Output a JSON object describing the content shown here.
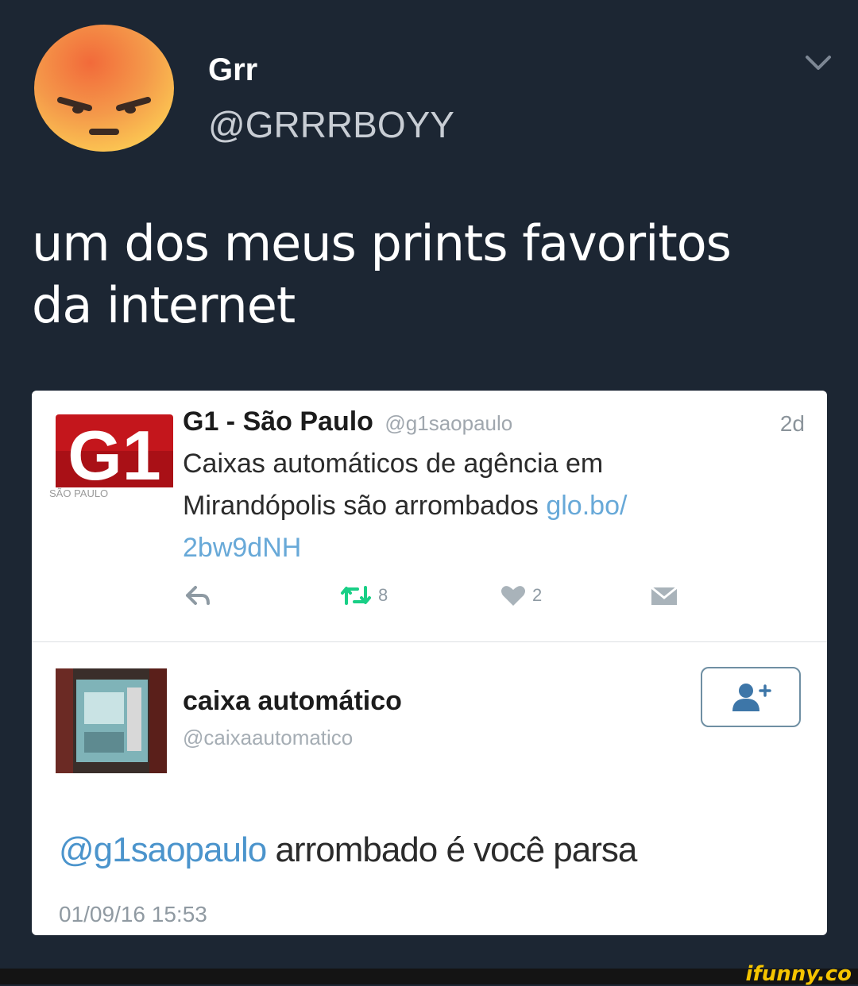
{
  "header": {
    "display_name": "Grr",
    "handle": "@GRRRBOYY"
  },
  "tweet": {
    "line1": "um dos meus prints favoritos",
    "line2": "da internet"
  },
  "quoted_tweet": {
    "logo_text": "G1",
    "logo_subtext": "SÃO PAULO",
    "name": "G1 - São Paulo",
    "handle": "@g1saopaulo",
    "time": "2d",
    "text_line1": "Caixas automáticos de agência em",
    "text_line2_plain": "Mirandópolis são arrombados ",
    "text_line2_link": "glo.bo/",
    "text_line3_link": "2bw9dNH",
    "retweet_count": "8",
    "like_count": "2"
  },
  "reply": {
    "account_name": "caixa automático",
    "account_handle": "@caixaautomatico",
    "mention": "@g1saopaulo",
    "text": " arrombado é você parsa",
    "timestamp": "01/09/16 15:53"
  },
  "watermark": "ifunny.co",
  "colors": {
    "background": "#1c2633",
    "link": "#68a9d8",
    "retweet_green": "#19cf86",
    "g1_red": "#c4161c"
  }
}
